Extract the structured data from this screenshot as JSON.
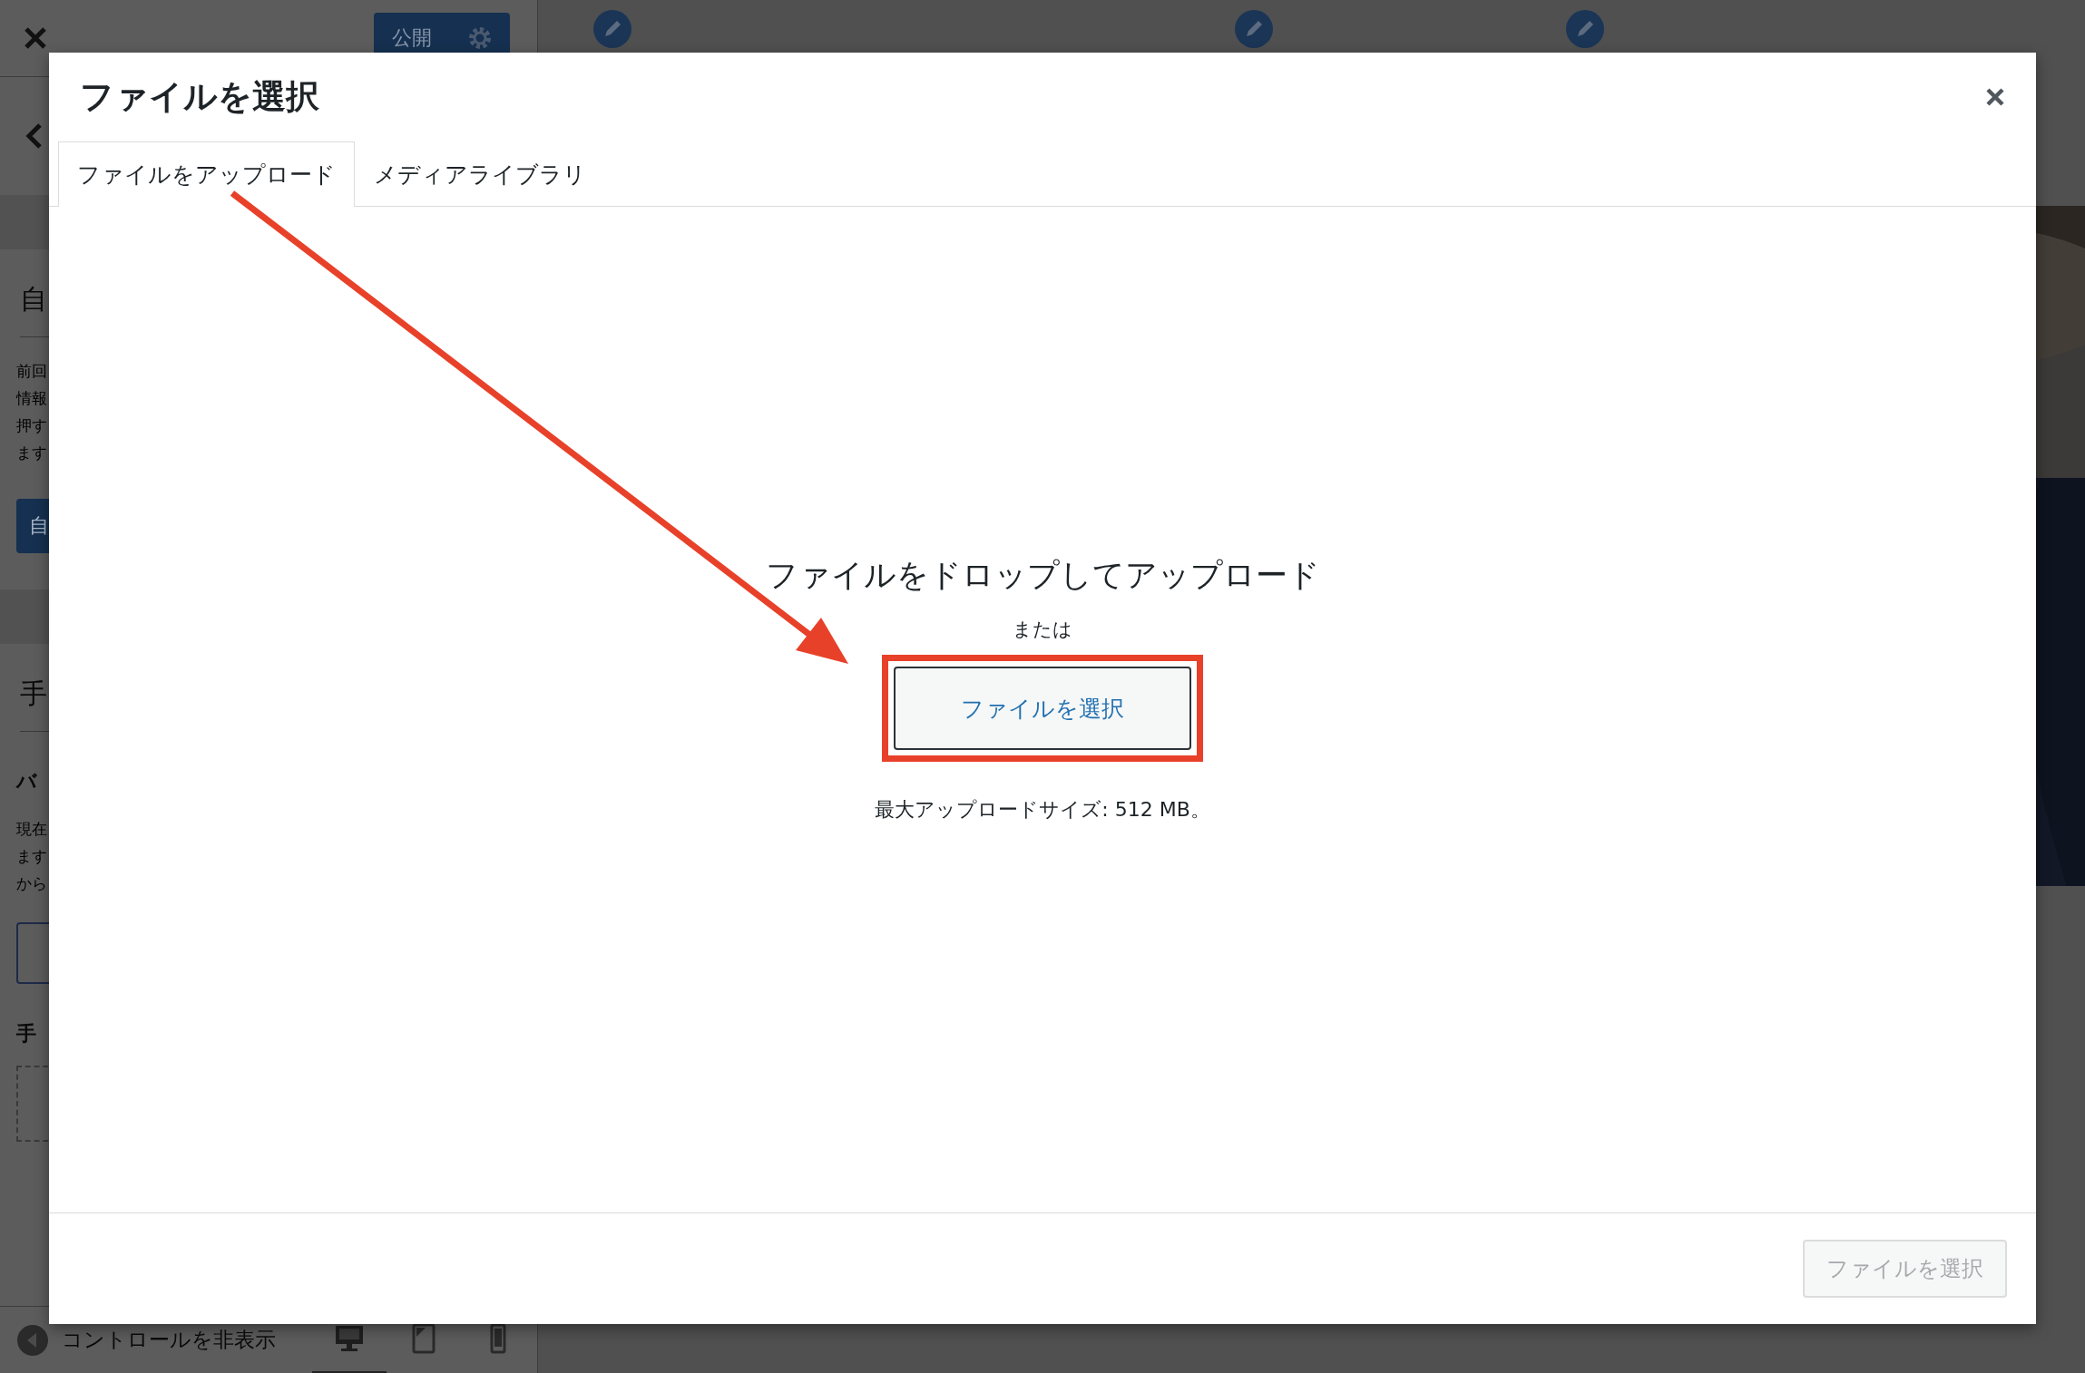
{
  "sidebar": {
    "publish_button": "公開",
    "items": [
      {
        "kind": "band"
      },
      {
        "kind": "heading",
        "text": "自"
      },
      {
        "kind": "rule"
      },
      {
        "kind": "para",
        "lines": [
          "前回",
          "情報",
          "押す",
          "ます"
        ]
      },
      {
        "kind": "button",
        "text": "自"
      },
      {
        "kind": "band"
      },
      {
        "kind": "heading",
        "text": "手"
      },
      {
        "kind": "rule"
      },
      {
        "kind": "subheading",
        "text": "バ"
      },
      {
        "kind": "para",
        "lines": [
          "現在",
          "ます",
          "から"
        ]
      },
      {
        "kind": "outline"
      },
      {
        "kind": "subheading",
        "text": "手"
      },
      {
        "kind": "dropzone"
      }
    ],
    "hide_controls": "コントロールを非表示",
    "devices": [
      {
        "kind": "desktop",
        "selected": true
      },
      {
        "kind": "tablet",
        "selected": false
      },
      {
        "kind": "mobile",
        "selected": false
      }
    ]
  },
  "modal": {
    "title": "ファイルを選択",
    "tabs": [
      {
        "label": "ファイルをアップロード",
        "selected": true
      },
      {
        "label": "メディアライブラリ",
        "selected": false
      }
    ],
    "drop_heading": "ファイルをドロップしてアップロード",
    "or": "または",
    "select_button": "ファイルを選択",
    "max_size": "最大アップロードサイズ: 512 MB。",
    "footer_button": {
      "label": "ファイルを選択",
      "disabled": true
    }
  }
}
